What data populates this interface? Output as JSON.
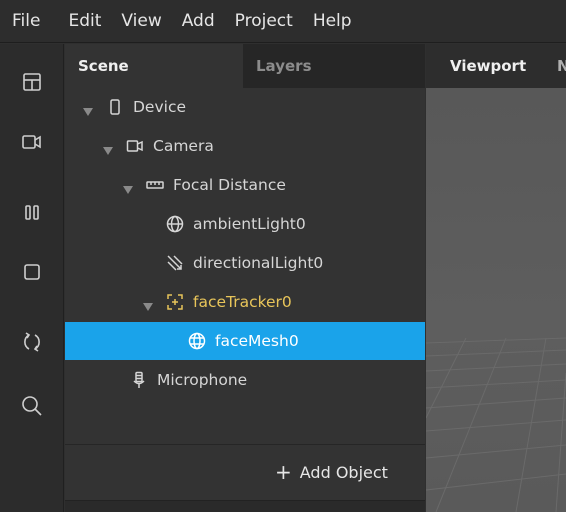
{
  "menubar": {
    "items": [
      "File",
      "Edit",
      "View",
      "Add",
      "Project",
      "Help"
    ]
  },
  "toolstrip": {
    "tools": [
      {
        "icon": "layout-icon"
      },
      {
        "icon": "camera-icon"
      },
      {
        "icon": "pause-bars-icon"
      },
      {
        "icon": "square-icon"
      },
      {
        "icon": "refresh-icon"
      },
      {
        "icon": "search-icon"
      }
    ]
  },
  "scene_panel": {
    "tabs": {
      "scene": "Scene",
      "layers": "Layers"
    },
    "tree": [
      {
        "label": "Device",
        "icon": "phone-icon"
      },
      {
        "label": "Camera",
        "icon": "camera-icon"
      },
      {
        "label": "Focal Distance",
        "icon": "ruler-icon"
      },
      {
        "label": "ambientLight0",
        "icon": "globe-icon"
      },
      {
        "label": "directionalLight0",
        "icon": "directional-light-icon"
      },
      {
        "label": "faceTracker0",
        "icon": "face-tracker-icon"
      },
      {
        "label": "faceMesh0",
        "icon": "mesh-icon"
      },
      {
        "label": "Microphone",
        "icon": "microphone-icon"
      }
    ],
    "selected": "faceMesh0",
    "add_object": {
      "plus": "+",
      "label": "Add Object"
    }
  },
  "viewport": {
    "tab": "Viewport",
    "tab2": "N"
  },
  "colors": {
    "selection": "#1aa3ea",
    "tracker": "#e8c55a"
  }
}
